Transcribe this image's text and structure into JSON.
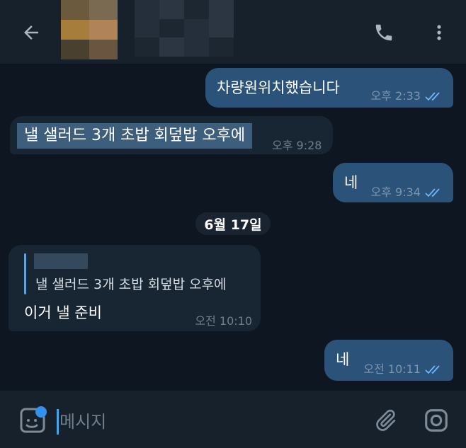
{
  "header": {
    "back_icon": "arrow-left-icon",
    "call_icon": "phone-icon",
    "menu_icon": "more-vertical-icon"
  },
  "messages": [
    {
      "direction": "out",
      "text": "차량원위치했습니다",
      "time": "오후 2:33",
      "status": "read"
    },
    {
      "direction": "in",
      "text": "낼 샐러드 3개 초밥 회덮밥 오후에",
      "time": "오후 9:28",
      "selected": true
    },
    {
      "direction": "out",
      "text": "네",
      "time": "오후 9:34",
      "status": "read"
    },
    {
      "direction": "in",
      "reply_text": "낼 샐러드 3개 초밥 회덮밥 오후에",
      "text": "이거 낼 준비",
      "time": "오전 10:10"
    },
    {
      "direction": "out",
      "text": "네",
      "time": "오전 10:11",
      "status": "read"
    }
  ],
  "date_separator": "6월 17일",
  "input": {
    "placeholder": "메시지",
    "sticker_icon": "sticker-icon",
    "attach_icon": "paperclip-icon",
    "camera_icon": "camera-icon"
  },
  "colors": {
    "background": "#0e1621",
    "header": "#17212b",
    "outgoing_bubble": "#2b5278",
    "incoming_bubble": "#182533",
    "accent": "#3390ec",
    "read_checks": "#6fb7ff"
  }
}
